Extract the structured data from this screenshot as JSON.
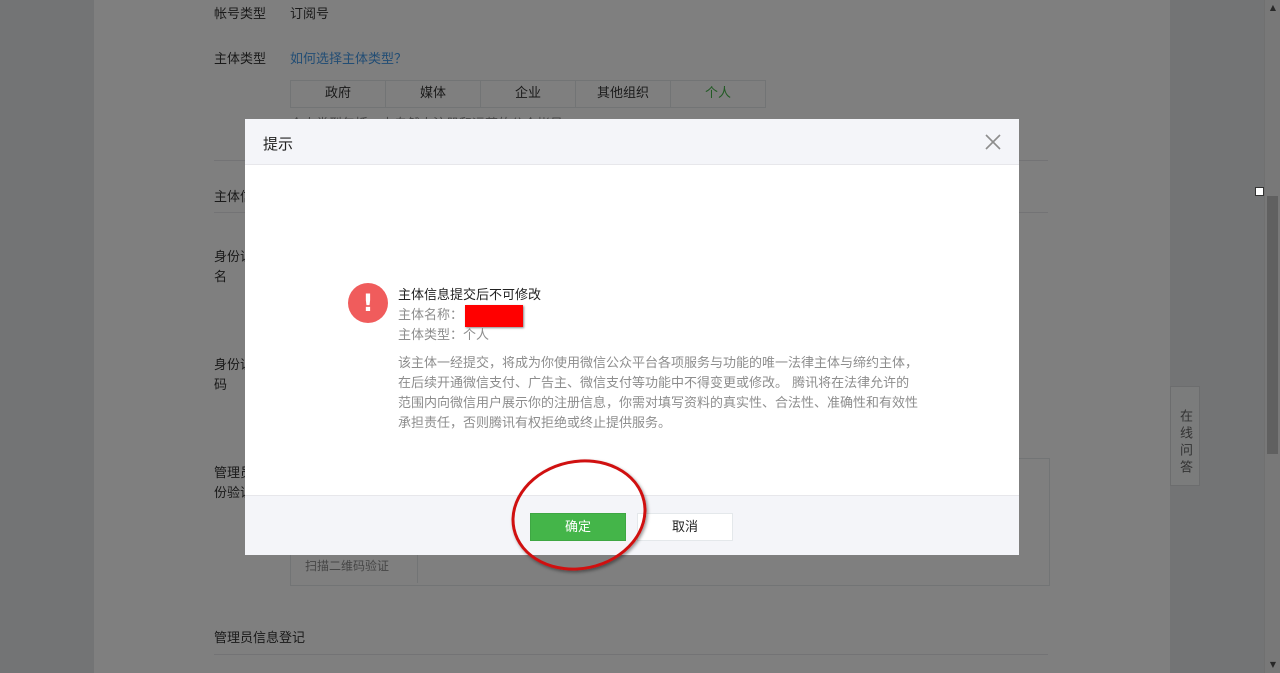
{
  "background_form": {
    "account_type_label": "帐号类型",
    "account_type_value": "订阅号",
    "subject_type_label": "主体类型",
    "subject_type_link": "如何选择主体类型？",
    "subject_tabs": [
      "政府",
      "媒体",
      "企业",
      "其他组织",
      "个人"
    ],
    "subject_note": "个人类型包括：由自然人注册和运营的公众帐号。",
    "subject_info_label": "主体信",
    "id_name_label_1": "身份证",
    "id_name_label_2": "名",
    "id_number_label_1": "身份证",
    "id_number_label_2": "码",
    "admin_verify_label_1": "管理员",
    "admin_verify_label_2": "份验证",
    "upload_hint": "扫描二维码验证",
    "admin_info_label": "管理员信息登记"
  },
  "side_help": {
    "label": "在线问答"
  },
  "dialog": {
    "title": "提示",
    "warning_title": "主体信息提交后不可修改",
    "subject_name_label": "主体名称：",
    "subject_type_line": "主体类型：个人",
    "description": "该主体一经提交，将成为你使用微信公众平台各项服务与功能的唯一法律主体与缔约主体，在后续开通微信支付、广告主、微信支付等功能中不得变更或修改。 腾讯将在法律允许的范围内向微信用户展示你的注册信息，你需对填写资料的真实性、合法性、准确性和有效性承担责任，否则腾讯有权拒绝或终止提供服务。",
    "confirm_label": "确定",
    "cancel_label": "取消"
  },
  "colors": {
    "accent_green": "#44b549",
    "warning_red": "#f05c5c",
    "annotation_red": "#d01010",
    "overlay": "rgba(0,0,0,0.5)"
  }
}
